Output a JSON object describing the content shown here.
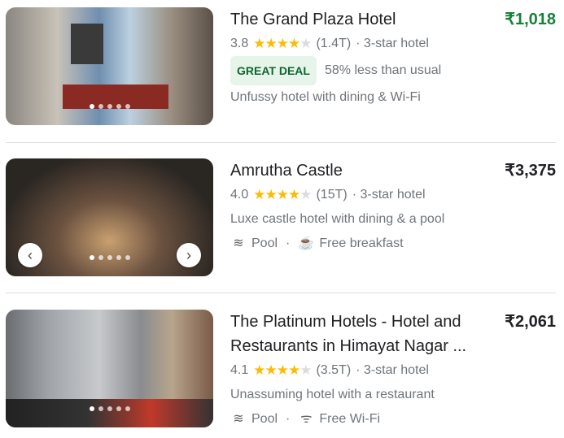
{
  "hotels": [
    {
      "name": "The Grand Plaza Hotel",
      "price": "₹1,018",
      "rating": "3.8",
      "reviews": "(1.4T)",
      "class": "· 3-star hotel",
      "badge": "GREAT DEAL",
      "deal": "58% less than usual",
      "desc": "Unfussy hotel with dining & Wi-Fi",
      "price_color": "#188038",
      "stars": 4
    },
    {
      "name": "Amrutha Castle",
      "price": "₹3,375",
      "rating": "4.0",
      "reviews": "(15T)",
      "class": "· 3-star hotel",
      "desc": "Luxe castle hotel with dining & a pool",
      "amenity1": "Pool",
      "sep": "·",
      "amenity2": "Free breakfast",
      "stars": 4
    },
    {
      "name": "The Platinum Hotels - Hotel and Restaurants in Himayat Nagar ...",
      "price": "₹2,061",
      "rating": "4.1",
      "reviews": "(3.5T)",
      "class": "· 3-star hotel",
      "desc": "Unassuming hotel with a restaurant",
      "amenity1": "Pool",
      "sep": "·",
      "amenity2": "Free Wi-Fi",
      "stars": 4
    }
  ]
}
